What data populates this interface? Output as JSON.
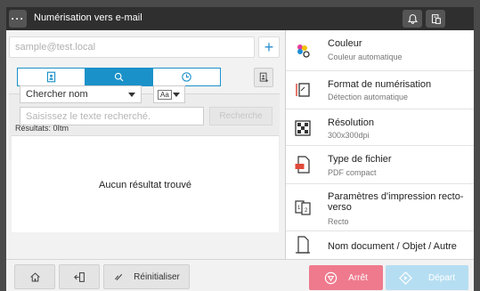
{
  "titlebar": {
    "title": "Numérisation vers e-mail",
    "menu_icon": "more-icon",
    "bell_icon": "bell-icon",
    "device_icon": "device-status-icon"
  },
  "address": {
    "placeholder": "sample@test.local",
    "add_label": "+"
  },
  "tabs": [
    {
      "icon": "address-book-icon",
      "active": false
    },
    {
      "icon": "search-icon",
      "active": true
    },
    {
      "icon": "history-icon",
      "active": false
    }
  ],
  "search": {
    "field_select": "Chercher nom",
    "case_label": "Aa",
    "placeholder": "Saisissez le texte recherché.",
    "button_label": "Recherche"
  },
  "results": {
    "label": "Résultats: 0Itm",
    "empty_text": "Aucun résultat trouvé"
  },
  "settings": [
    {
      "title": "Couleur",
      "subtitle": "Couleur automatique",
      "icon": "color-icon"
    },
    {
      "title": "Format de numérisation",
      "subtitle": "Détection automatique",
      "icon": "scan-size-icon"
    },
    {
      "title": "Résolution",
      "subtitle": "300x300dpi",
      "icon": "resolution-icon"
    },
    {
      "title": "Type de fichier",
      "subtitle": "PDF compact",
      "icon": "file-type-icon",
      "badge": "PDF"
    },
    {
      "title": "Paramètres d'impression recto-verso",
      "subtitle": "Recto",
      "icon": "duplex-icon"
    },
    {
      "title": "Nom document / Objet / Autre",
      "subtitle": "",
      "icon": "document-icon"
    }
  ],
  "bottom": {
    "reset_label": "Réinitialiser",
    "stop_label": "Arrêt",
    "start_label": "Départ"
  },
  "colors": {
    "accent": "#1b91c9",
    "stop": "#ef7a8d",
    "start": "#b6def2",
    "titlebar": "#2f2f2f"
  }
}
